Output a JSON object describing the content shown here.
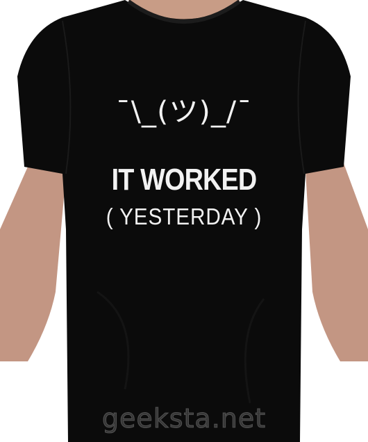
{
  "shirt_print": {
    "shrug": "¯\\_(ツ)_/¯",
    "headline": "IT WORKED",
    "subline": "( YESTERDAY )"
  },
  "watermark": "geeksta.net",
  "colors": {
    "shirt": "#0b0b0b",
    "print": "#f2f2f2",
    "skin": "#c89c86",
    "background": "#ffffff"
  }
}
